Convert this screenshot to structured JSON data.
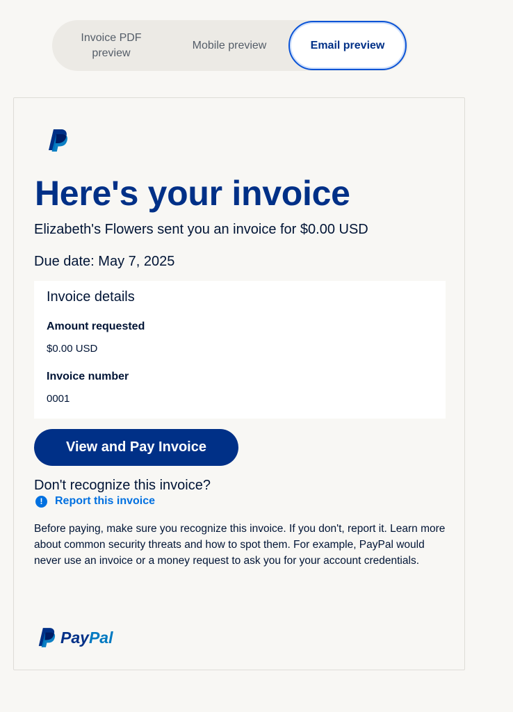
{
  "preview_toggle": {
    "pdf_label": "Invoice PDF preview",
    "mobile_label": "Mobile preview",
    "email_label": "Email preview",
    "selected": "Email preview"
  },
  "email": {
    "headline": "Here's your invoice",
    "subline": "Elizabeth's Flowers sent you an invoice for $0.00 USD",
    "due_date": "Due date: May 7, 2025",
    "details": {
      "title": "Invoice details",
      "amount_label": "Amount requested",
      "amount_value": "$0.00 USD",
      "number_label": "Invoice number",
      "number_value": "0001"
    },
    "pay_button": "View and Pay Invoice",
    "dont_recognize": "Don't recognize this invoice?",
    "report_link": "Report this invoice",
    "disclaimer": "Before paying, make sure you recognize this invoice. If you don't, report it. Learn more about common security threats and how to spot them. For example, PayPal would never use an invoice or a money request to ask you for your account credentials.",
    "footer_brand_pay": "Pay",
    "footer_brand_pal": "Pal"
  },
  "colors": {
    "brand_dark": "#003087",
    "brand_light": "#0070e0",
    "text": "#001435",
    "page_bg": "#f8f7f4"
  }
}
